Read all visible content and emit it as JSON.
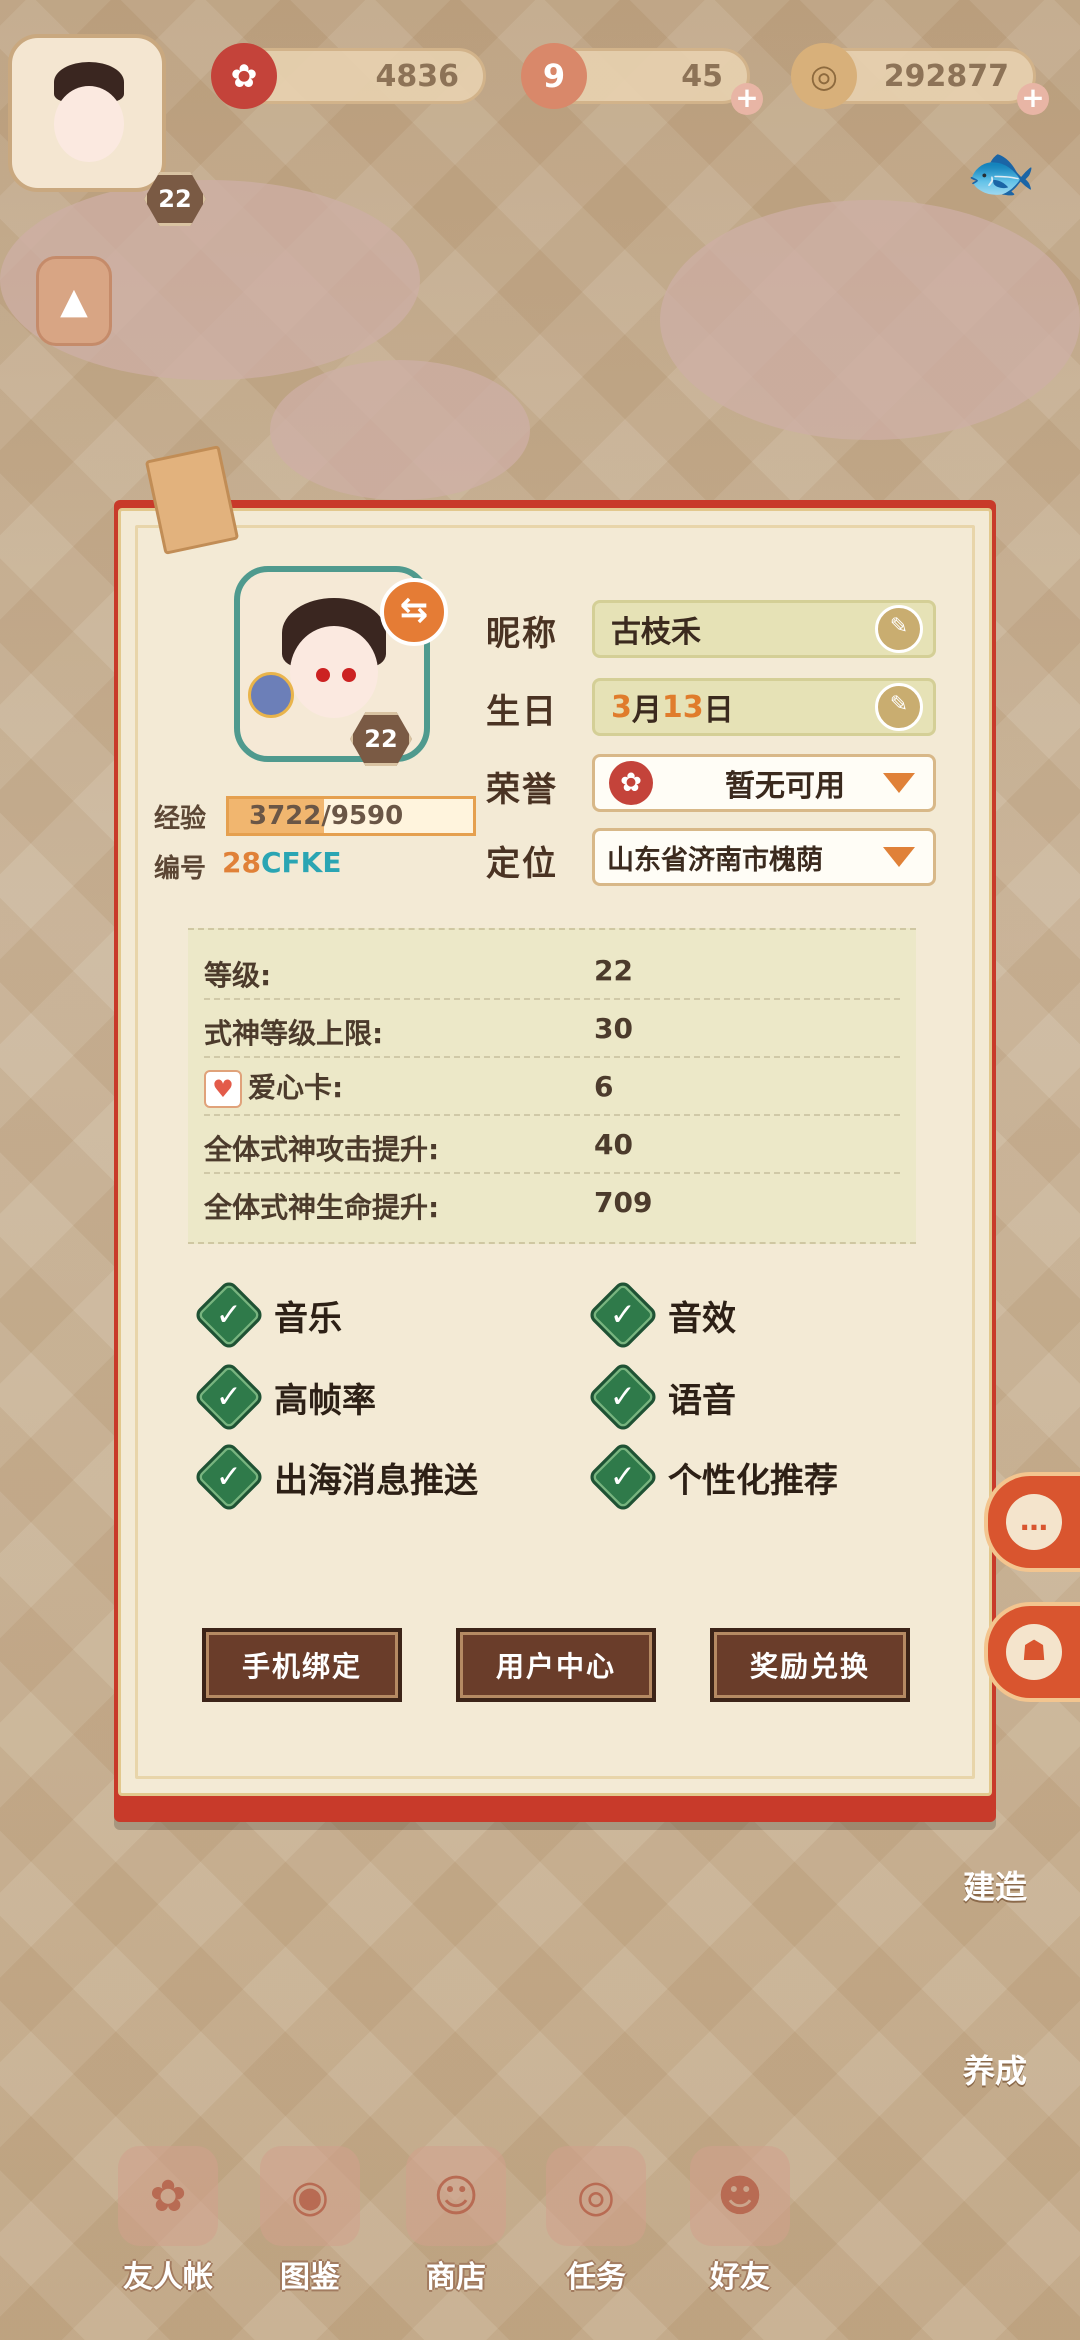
{
  "top_bar": {
    "player_level": "22",
    "resources": [
      {
        "name": "gold-coin-stamina",
        "icon": "plum-blossom-icon",
        "value": "4836"
      },
      {
        "name": "magatama",
        "icon": "magatama-icon",
        "value": "45"
      },
      {
        "name": "coins",
        "icon": "coin-icon",
        "value": "292877"
      }
    ]
  },
  "profile": {
    "nickname_label": "昵称",
    "nickname_value": "古枝禾",
    "birthday_label": "生日",
    "birthday_month": "3",
    "birthday_month_unit": "月",
    "birthday_day": "13",
    "birthday_day_unit": "日",
    "honor_label": "荣誉",
    "honor_value": "暂无可用",
    "location_label": "定位",
    "location_value": "山东省济南市槐荫",
    "portrait_level": "22",
    "exp_label": "经验",
    "exp_value": "3722/9590",
    "exp_progress": 0.388,
    "id_label": "编号",
    "id_part1": "28",
    "id_part2": "CFKE"
  },
  "stats": [
    {
      "key": "等级:",
      "value": "22"
    },
    {
      "key": "式神等级上限:",
      "value": "30"
    },
    {
      "key": "爱心卡:",
      "value": "6"
    },
    {
      "key": "全体式神攻击提升:",
      "value": "40"
    },
    {
      "key": "全体式神生命提升:",
      "value": "709"
    }
  ],
  "settings": {
    "music": "音乐",
    "sound_effects": "音效",
    "high_frame_rate": "高帧率",
    "voice": "语音",
    "push_notifications": "出海消息推送",
    "personalized_recommend": "个性化推荐"
  },
  "buttons": {
    "phone_bind": "手机绑定",
    "user_center": "用户中心",
    "reward_exchange": "奖励兑换"
  },
  "right_tabs": {
    "build": "建造",
    "raise": "养成"
  },
  "bottom_nav": [
    "友人帐",
    "图鉴",
    "商店",
    "任务",
    "好友"
  ],
  "colors": {
    "panel_red": "#c83a2a",
    "check_green": "#2f7a4a",
    "accent_orange": "#e08138",
    "id_teal": "#2aa5b3"
  }
}
